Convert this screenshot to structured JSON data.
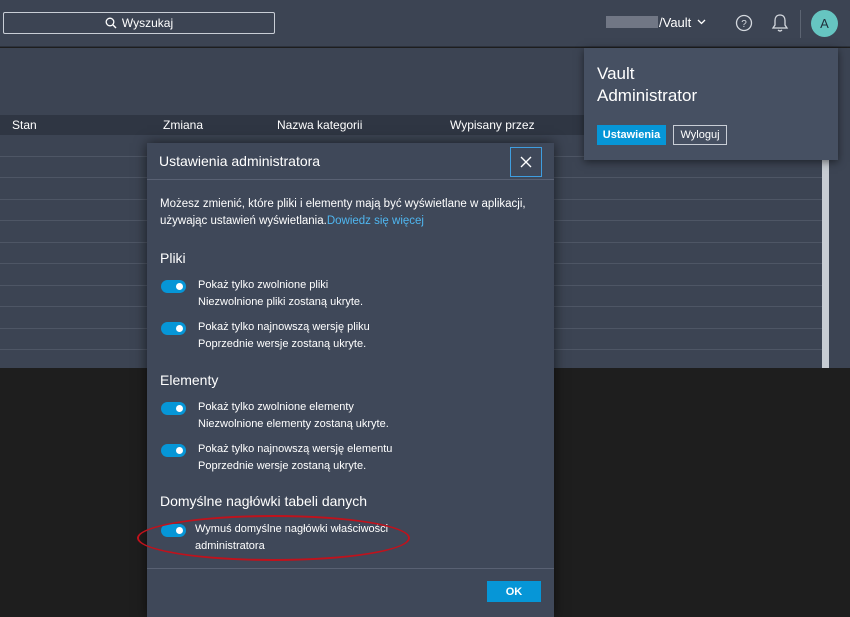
{
  "header": {
    "search_label": "Wyszukaj",
    "vault_name": "/Vault",
    "avatar_letter": "A"
  },
  "table": {
    "columns": [
      "Stan",
      "Zmiana",
      "Nazwa kategorii",
      "Wypisany przez"
    ]
  },
  "account_popover": {
    "name_line1": "Vault",
    "name_line2": "Administrator",
    "settings_label": "Ustawienia",
    "logout_label": "Wyloguj"
  },
  "dialog": {
    "title": "Ustawienia administratora",
    "intro_text": "Możesz zmienić, które pliki i elementy mają być wyświetlane w aplikacji, używając ustawień wyświetlania.",
    "learn_more": "Dowiedz się więcej",
    "sections": {
      "files": "Pliki",
      "items": "Elementy",
      "headers": "Domyślne nagłówki tabeli danych"
    },
    "options": {
      "released_files": {
        "label": "Pokaż tylko zwolnione pliki",
        "desc": "Niezwolnione pliki zostaną ukryte.",
        "on": true
      },
      "latest_file": {
        "label": "Pokaż tylko najnowszą wersję pliku",
        "desc": "Poprzednie wersje zostaną ukryte.",
        "on": true
      },
      "released_items": {
        "label": "Pokaż tylko zwolnione elementy",
        "desc": "Niezwolnione elementy zostaną ukryte.",
        "on": true
      },
      "latest_item": {
        "label": "Pokaż tylko najnowszą wersję elementu",
        "desc": "Poprzednie wersje zostaną ukryte.",
        "on": true
      },
      "force_headers": {
        "label": "Wymuś domyślne nagłówki właściwości",
        "desc": "administratora",
        "on": true
      }
    },
    "ok_label": "OK"
  },
  "colors": {
    "accent": "#0696d7",
    "link": "#4fb6f0",
    "highlight": "#c0121c"
  }
}
